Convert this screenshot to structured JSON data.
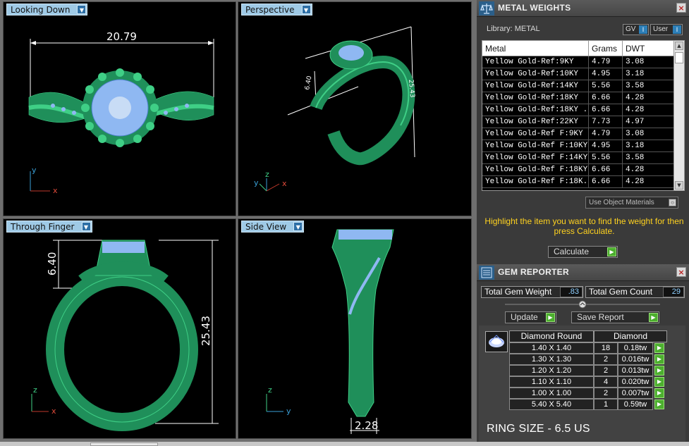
{
  "viewports": {
    "looking_down": {
      "label": "Looking Down",
      "dim": "20.79",
      "axis_v": "y",
      "axis_h": "x"
    },
    "perspective": {
      "label": "Perspective",
      "dim_a": "6.40",
      "dim_b": "25.43",
      "axis_a": "y",
      "axis_b": "z",
      "axis_c": "x"
    },
    "through_finger": {
      "label": "Through Finger",
      "dim_top": "6.40",
      "dim_height": "25.43",
      "axis_v": "z",
      "axis_h": "x"
    },
    "side_view": {
      "label": "Side View",
      "dim_bottom": "2.28",
      "axis_v": "z",
      "axis_h": "y"
    }
  },
  "metal_weights": {
    "title": "METAL WEIGHTS",
    "library_label": "Library: METAL",
    "toggle_gv": "GV",
    "toggle_user": "User",
    "columns": [
      "Metal",
      "Grams",
      "DWT"
    ],
    "rows": [
      [
        "Yellow Gold-Ref:9KY",
        "4.79",
        "3.08"
      ],
      [
        "Yellow Gold-Ref:10KY",
        "4.95",
        "3.18"
      ],
      [
        "Yellow Gold-Ref:14KY",
        "5.56",
        "3.58"
      ],
      [
        "Yellow Gold-Ref:18KY",
        "6.66",
        "4.28"
      ],
      [
        "Yellow Gold-Ref:18KY ...",
        "6.66",
        "4.28"
      ],
      [
        "Yellow Gold-Ref:22KY",
        "7.73",
        "4.97"
      ],
      [
        "Yellow Gold-Ref F:9KY",
        "4.79",
        "3.08"
      ],
      [
        "Yellow Gold-Ref F:10KY",
        "4.95",
        "3.18"
      ],
      [
        "Yellow Gold-Ref F:14KY",
        "5.56",
        "3.58"
      ],
      [
        "Yellow Gold-Ref F:18KY",
        "6.66",
        "4.28"
      ],
      [
        "Yellow Gold-Ref F:18K...",
        "6.66",
        "4.28"
      ]
    ],
    "use_object_materials": "Use Object Materials",
    "hint": "Highlight the item you want to find the weight for then press Calculate.",
    "calculate_label": "Calculate"
  },
  "gem_reporter": {
    "title": "GEM REPORTER",
    "total_weight_label": "Total Gem Weight",
    "total_weight_value": ".83",
    "total_count_label": "Total Gem Count",
    "total_count_value": "29",
    "update_label": "Update",
    "save_report_label": "Save Report",
    "header_shape": "Diamond Round",
    "header_material": "Diamond",
    "rows": [
      {
        "size": "1.40 X 1.40",
        "count": "18",
        "tw": "0.18tw"
      },
      {
        "size": "1.30 X 1.30",
        "count": "2",
        "tw": "0.016tw"
      },
      {
        "size": "1.20 X 1.20",
        "count": "2",
        "tw": "0.013tw"
      },
      {
        "size": "1.10 X 1.10",
        "count": "4",
        "tw": "0.020tw"
      },
      {
        "size": "1.00 X 1.00",
        "count": "2",
        "tw": "0.007tw"
      },
      {
        "size": "5.40 X 5.40",
        "count": "1",
        "tw": "0.59tw"
      }
    ],
    "ring_size": "RING SIZE - 6.5 US"
  },
  "colors": {
    "metal": "#1f8f5a",
    "stone": "#8fb8f2",
    "viewport_tab": "#9fcae6",
    "hint": "#ffd21f"
  },
  "icons": [
    "dropdown-arrow-icon",
    "close-icon",
    "go-arrow-icon",
    "scale-icon",
    "gem-report-icon",
    "diamond-thumbnail-icon"
  ]
}
